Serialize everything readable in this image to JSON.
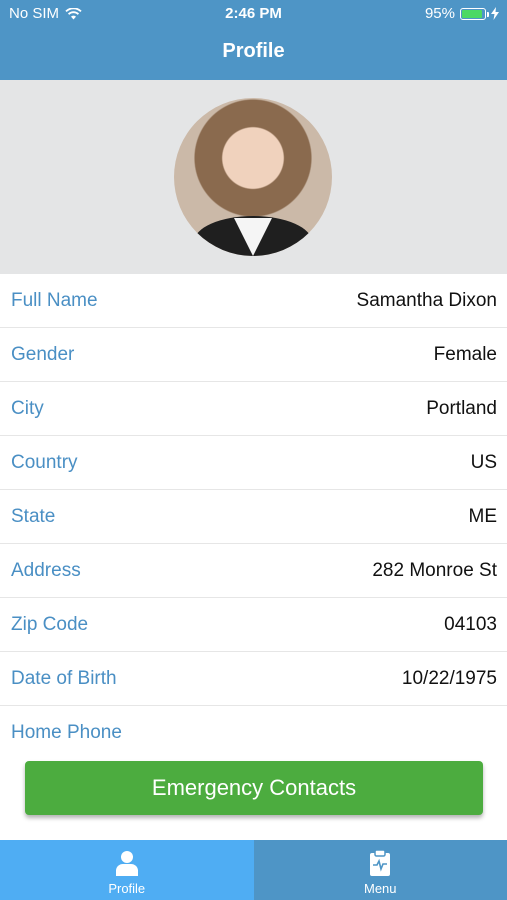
{
  "status_bar": {
    "carrier": "No SIM",
    "time": "2:46 PM",
    "battery": "95%",
    "battery_level": 0.95
  },
  "nav": {
    "title": "Profile"
  },
  "profile": {
    "avatar_alt": "profile-photo"
  },
  "fields": [
    {
      "label": "Full Name",
      "value": "Samantha Dixon"
    },
    {
      "label": "Gender",
      "value": "Female"
    },
    {
      "label": "City",
      "value": "Portland"
    },
    {
      "label": "Country",
      "value": "US"
    },
    {
      "label": "State",
      "value": "ME"
    },
    {
      "label": "Address",
      "value": "282 Monroe St"
    },
    {
      "label": "Zip Code",
      "value": "04103"
    },
    {
      "label": "Date of Birth",
      "value": "10/22/1975"
    },
    {
      "label": "Home Phone",
      "value": ""
    }
  ],
  "actions": {
    "emergency_contacts": "Emergency Contacts"
  },
  "tabs": [
    {
      "label": "Profile",
      "icon": "person-icon",
      "active": true
    },
    {
      "label": "Menu",
      "icon": "clipboard-icon",
      "active": false
    }
  ],
  "colors": {
    "header": "#4e95c6",
    "active_tab": "#4fadf3",
    "label": "#4a8fc4",
    "button": "#4cac3f"
  }
}
